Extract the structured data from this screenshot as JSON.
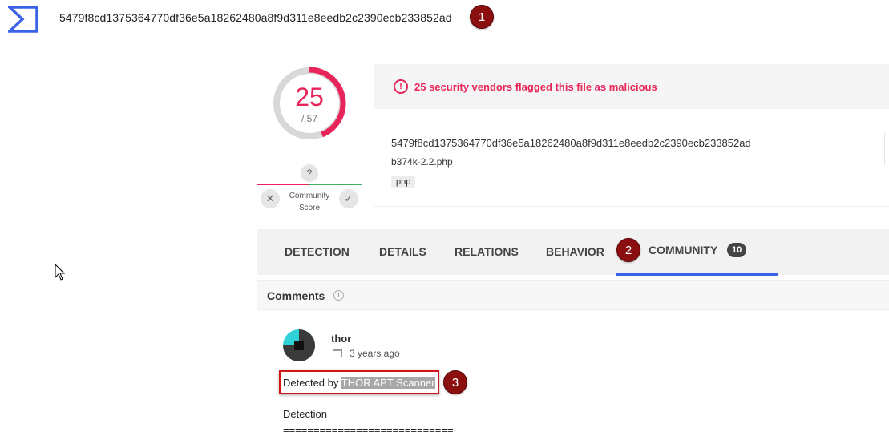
{
  "header": {
    "search_value": "5479f8cd1375364770df36e5a18262480a8f9d311e8eedb2c2390ecb233852ad"
  },
  "markers": [
    "1",
    "2",
    "3"
  ],
  "score": {
    "detections": "25",
    "total": "/ 57",
    "fraction": 0.4386,
    "color": "#e8255a"
  },
  "community_score": {
    "question": "?",
    "label": "Community Score",
    "vote_down": "✕",
    "vote_up": "✓"
  },
  "alert": {
    "text": "25 security vendors flagged this file as malicious"
  },
  "file": {
    "hash": "5479f8cd1375364770df36e5a18262480a8f9d311e8eedb2c2390ecb233852ad",
    "name": "b374k-2.2.php",
    "tag": "php"
  },
  "tabs": {
    "detection": "DETECTION",
    "details": "DETAILS",
    "relations": "RELATIONS",
    "behavior": "BEHAVIOR",
    "community": "COMMUNITY",
    "community_count": "10"
  },
  "comments": {
    "title": "Comments",
    "info": "i",
    "author": "thor",
    "time": "3 years ago",
    "detected_prefix": "Detected by ",
    "detected_scanner": "THOR APT Scanner",
    "body_heading": "Detection",
    "body_rule": "============================"
  },
  "colors": {
    "accent": "#3b61e8",
    "malicious": "#e8255a",
    "harmless": "#3fae60",
    "marker": "#8b0f0f"
  }
}
